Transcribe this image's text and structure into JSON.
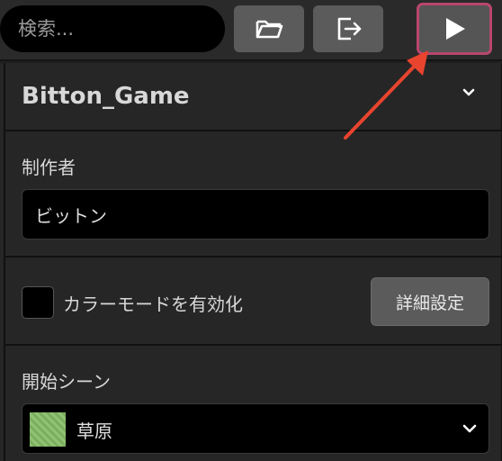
{
  "toolbar": {
    "search_placeholder": "検索...",
    "open_icon": "folder-open-icon",
    "export_icon": "export-icon",
    "play_icon": "play-icon"
  },
  "panel": {
    "game_title": "Bitton_Game",
    "author_label": "制作者",
    "author_value": "ビットン",
    "color_mode_label": "カラーモードを有効化",
    "color_mode_checked": false,
    "detail_button": "詳細設定",
    "start_scene_label": "開始シーン",
    "start_scene_value": "草原"
  },
  "colors": {
    "accent_border": "#b8466e",
    "annotation_arrow": "#e8442e",
    "scene_swatch": "#86b86a"
  }
}
